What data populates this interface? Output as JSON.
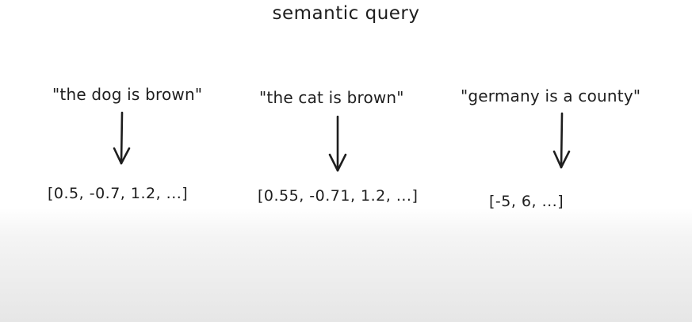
{
  "title": "semantic query",
  "columns": [
    {
      "sentence": "\"the dog is brown\"",
      "vector": "[0.5, -0.7, 1.2, ...]"
    },
    {
      "sentence": "\"the cat is brown\"",
      "vector": "[0.55, -0.71, 1.2, ...]"
    },
    {
      "sentence": "\"germany is a county\"",
      "vector": "[-5, 6, ...]"
    }
  ]
}
